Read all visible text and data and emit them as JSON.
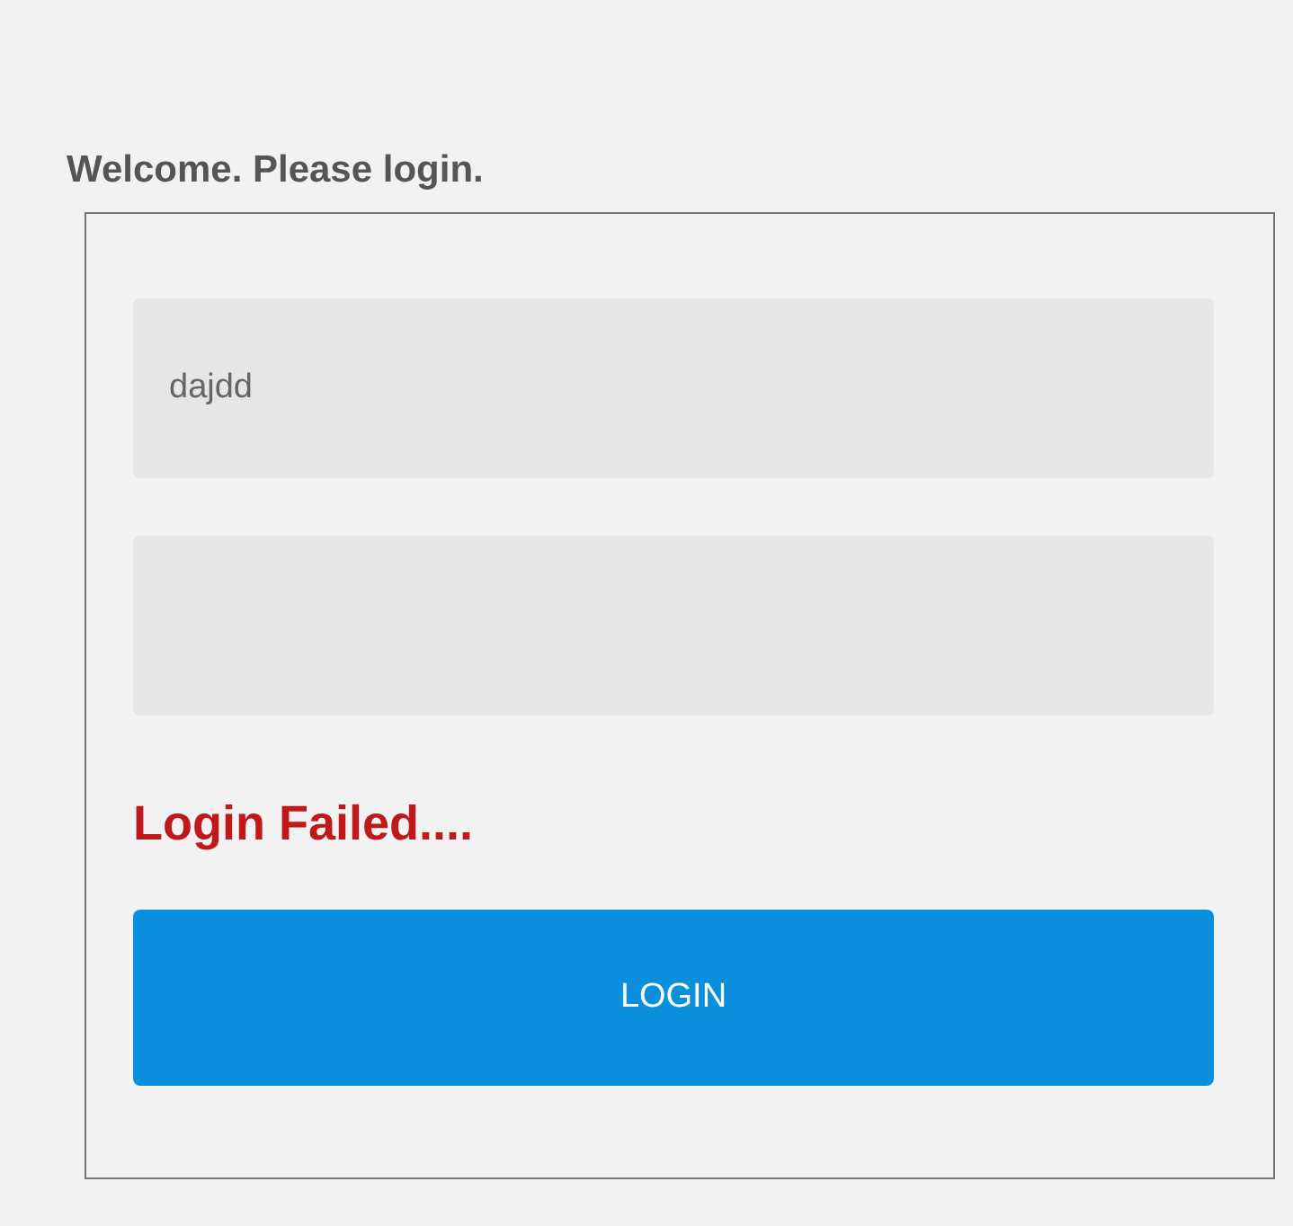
{
  "heading": "Welcome. Please login.",
  "fields": [
    {
      "kind": "text",
      "value": "dajdd"
    },
    {
      "kind": "password"
    }
  ],
  "error": "Login Failed....",
  "button": "LOGIN"
}
